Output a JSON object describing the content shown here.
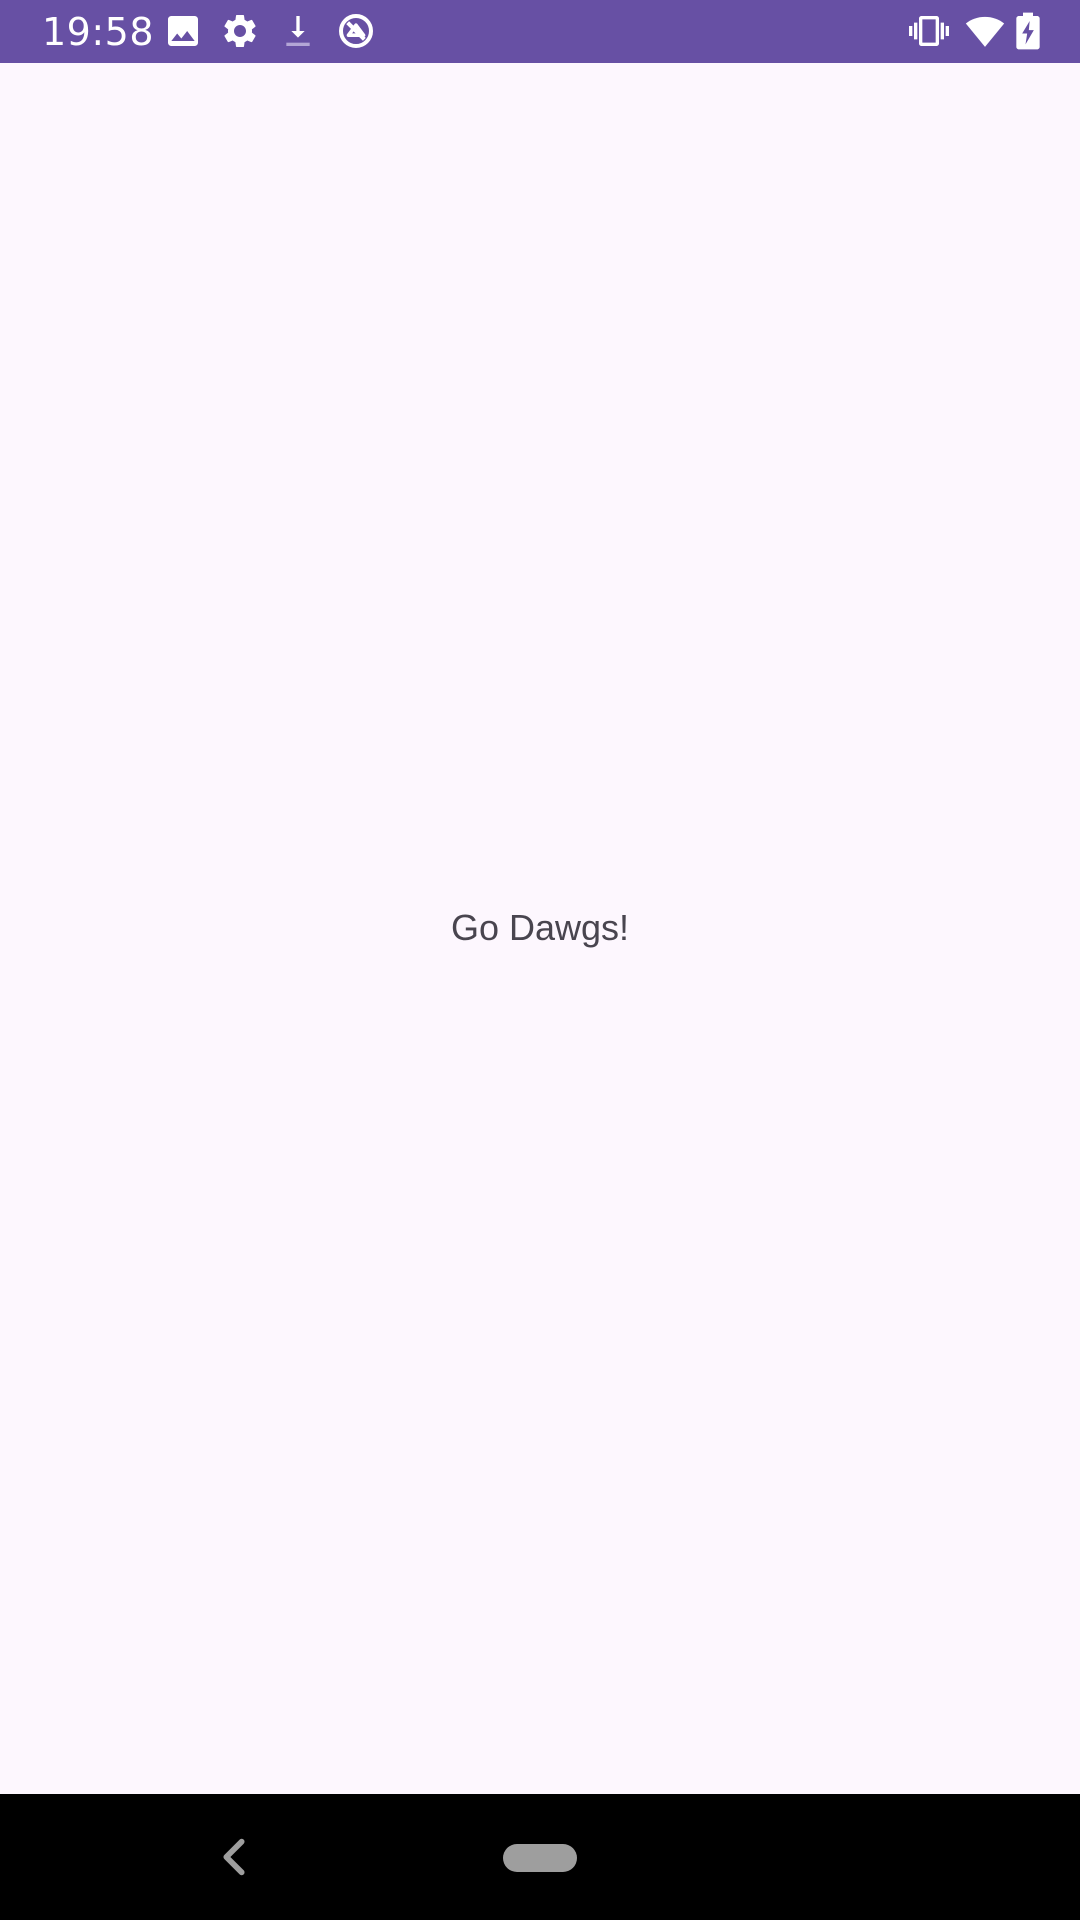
{
  "status_bar": {
    "time": "19:58",
    "left_icons": [
      "gallery-icon",
      "settings-icon",
      "download-icon",
      "accessibility-icon"
    ],
    "right_icons": [
      "vibrate-icon",
      "wifi-icon",
      "battery-charging-icon"
    ],
    "color": "#6750a4"
  },
  "main": {
    "greeting": "Go Dawgs!",
    "background_color": "#fdf7fe",
    "text_color": "#49454f"
  },
  "nav_bar": {
    "buttons": [
      "back-icon",
      "home-pill"
    ],
    "color": "#000000"
  }
}
